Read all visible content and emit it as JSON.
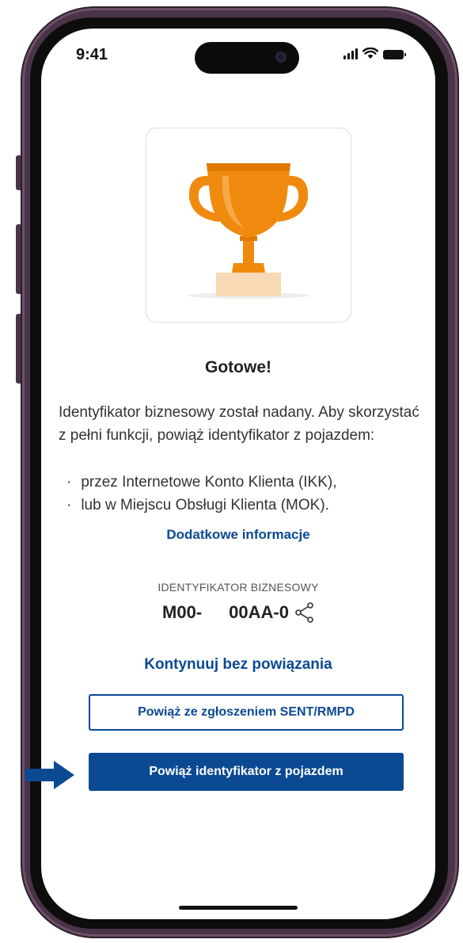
{
  "status_bar": {
    "time": "9:41"
  },
  "success": {
    "title": "Gotowe!",
    "description": "Identyfikator biznesowy został nadany. Aby skorzystać z pełni funkcji, powiąż identyfikator z pojazdem:",
    "bullets": [
      "przez Internetowe Konto Klienta (IKK),",
      "lub w Miejscu Obsługi Klienta (MOK)."
    ],
    "more_info_link": "Dodatkowe informacje"
  },
  "identifier": {
    "label": "IDENTYFIKATOR BIZNESOWY",
    "value_part1": "M00-",
    "value_part2": "00AA-0",
    "share_icon": "share-icon"
  },
  "actions": {
    "continue_link": "Kontynuuj bez powiązania",
    "link_sent_button": "Powiąż ze zgłoszeniem SENT/RMPD",
    "link_vehicle_button": "Powiąż identyfikator z pojazdem"
  },
  "colors": {
    "accent": "#0b4a93",
    "trophy": "#f08a0f",
    "pedestal": "#f7d9b5",
    "phone_frame": "#4a3447"
  }
}
